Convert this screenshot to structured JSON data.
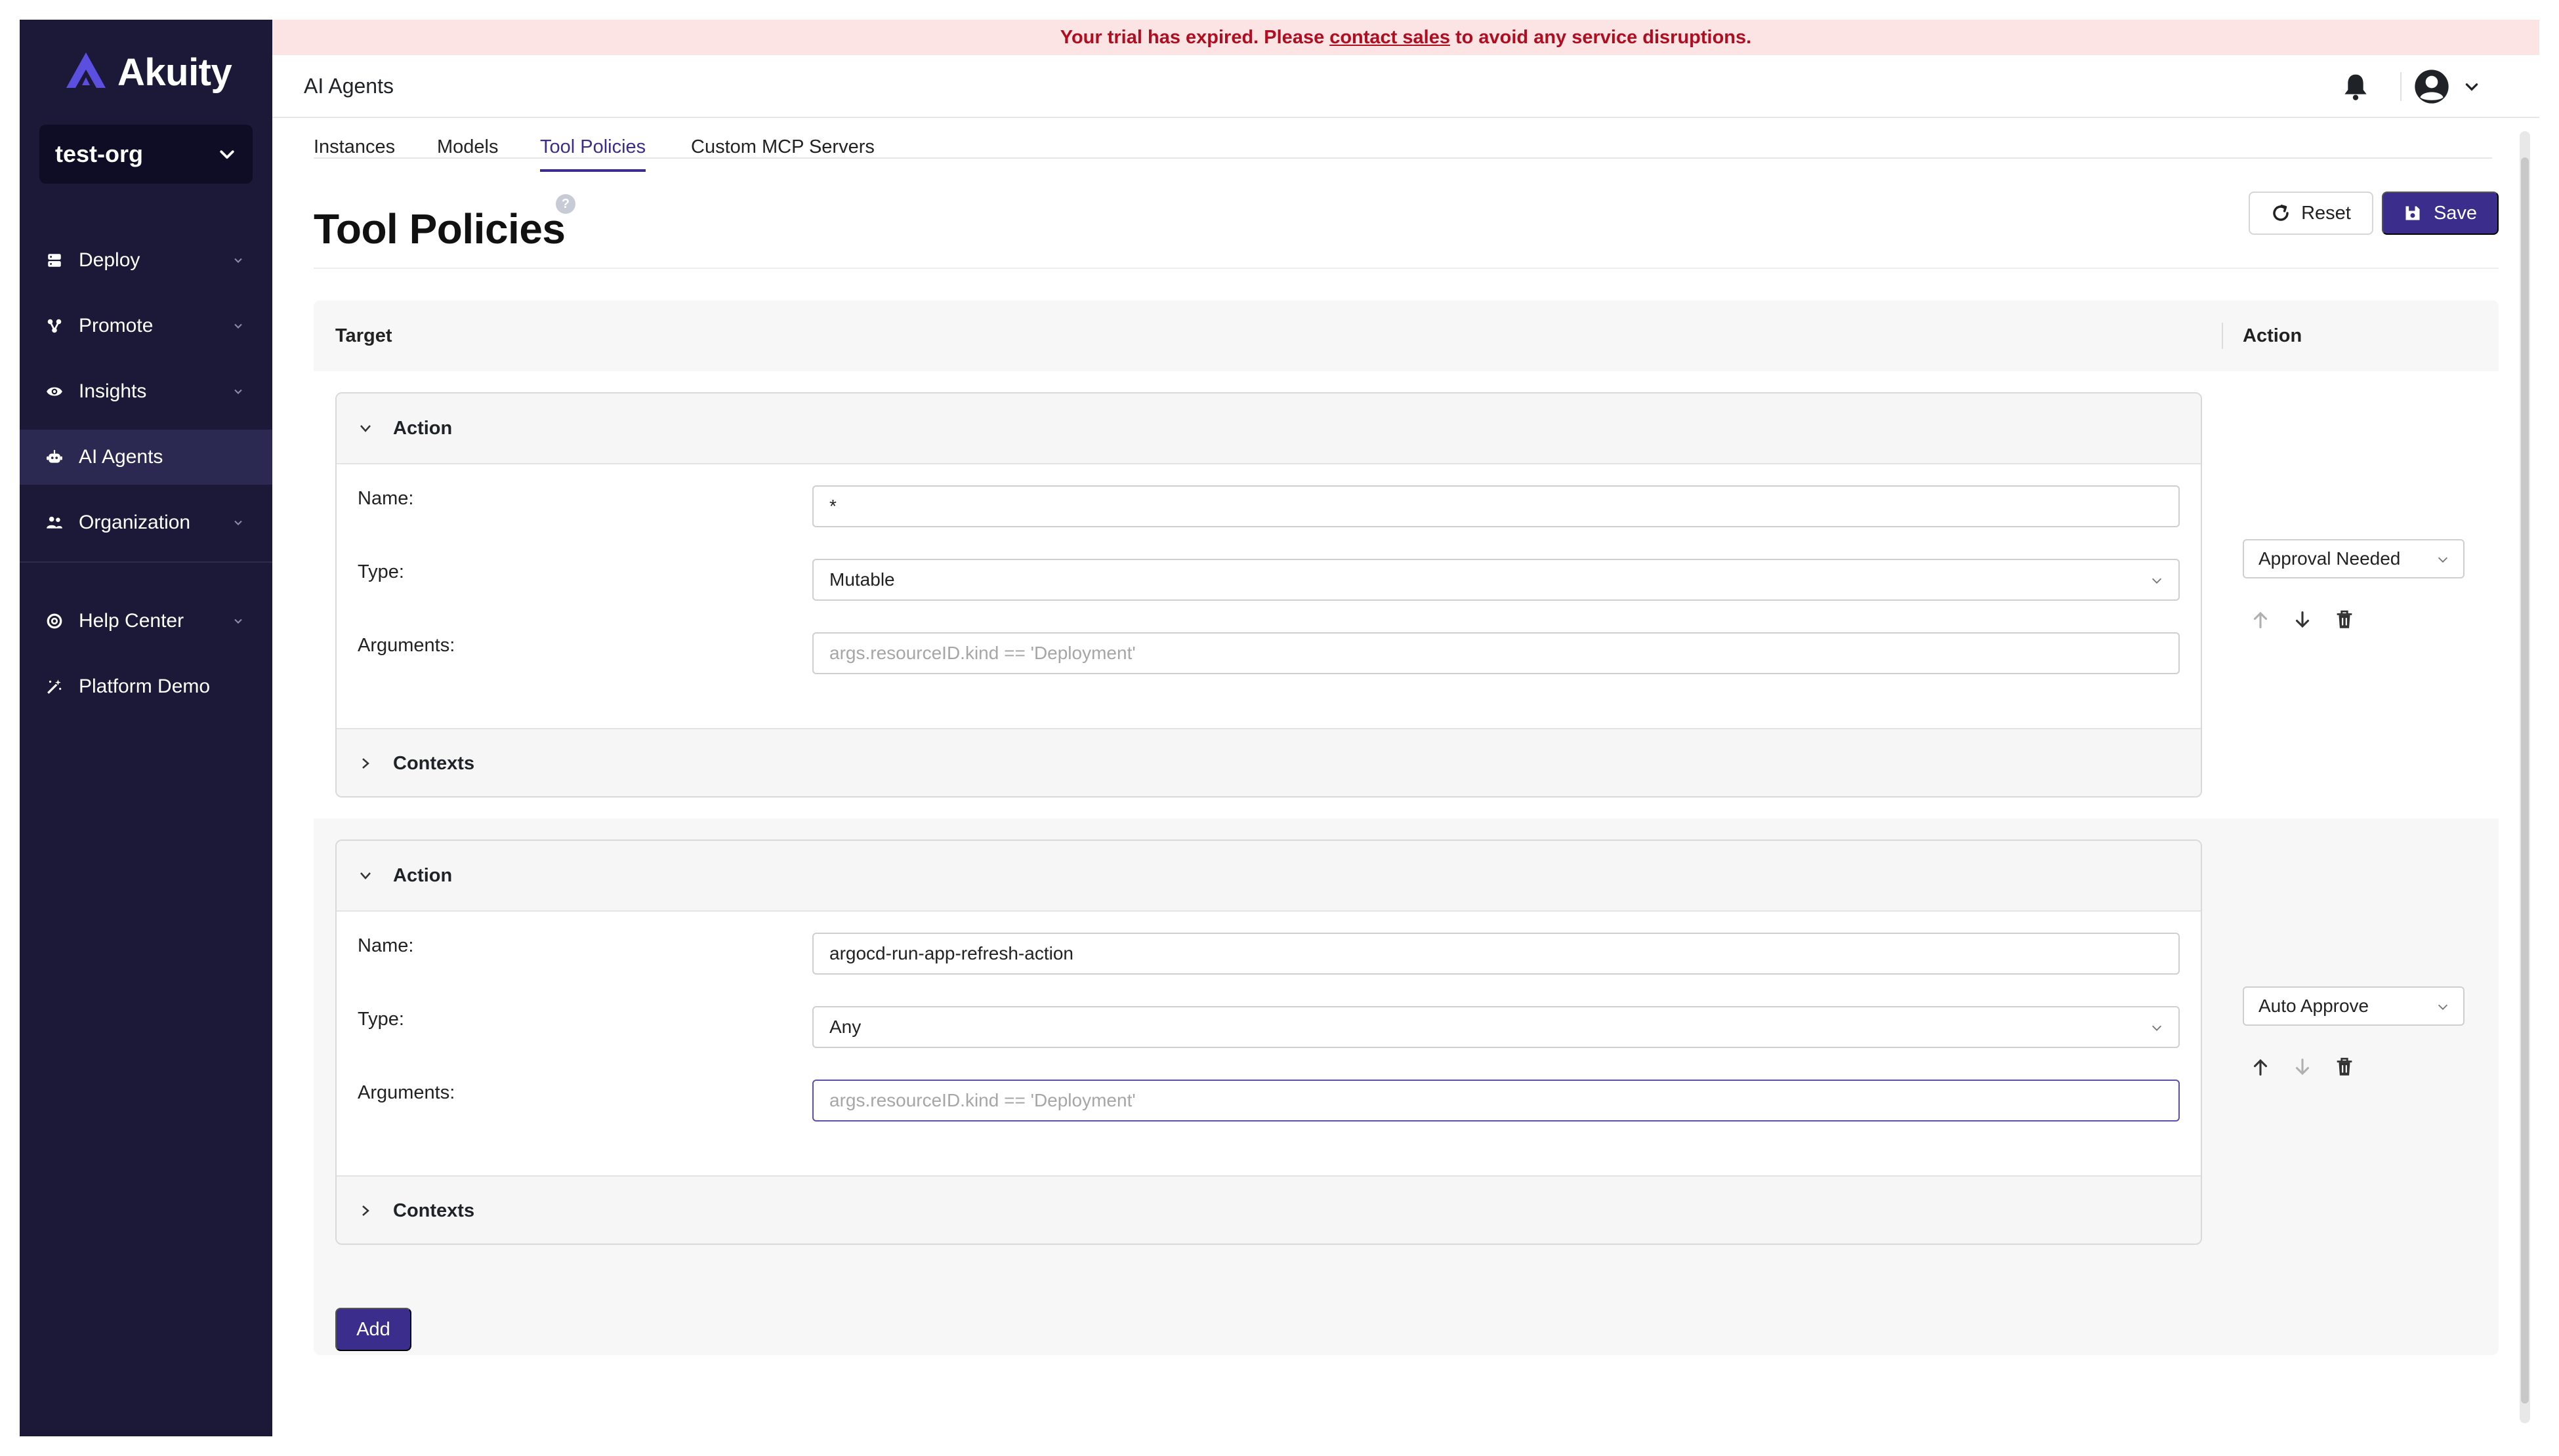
{
  "brand": {
    "name": "Akuity",
    "accent": "#4b3fd6"
  },
  "org": {
    "name": "test-org"
  },
  "sidebar": {
    "items": [
      {
        "label": "Deploy",
        "icon": "server-icon",
        "expandable": true
      },
      {
        "label": "Promote",
        "icon": "promote-icon",
        "expandable": true
      },
      {
        "label": "Insights",
        "icon": "eye-icon",
        "expandable": true
      },
      {
        "label": "AI Agents",
        "icon": "robot-icon",
        "expandable": false,
        "active": true
      },
      {
        "label": "Organization",
        "icon": "users-icon",
        "expandable": true
      },
      {
        "label": "Help Center",
        "icon": "lifebuoy-icon",
        "expandable": true
      },
      {
        "label": "Platform Demo",
        "icon": "wand-icon",
        "expandable": false
      }
    ]
  },
  "banner": {
    "before": "Your trial has expired. Please",
    "link": "contact sales",
    "after": "to avoid any service disruptions."
  },
  "topbar": {
    "title": "AI Agents"
  },
  "tabs": [
    {
      "label": "Instances",
      "active": false
    },
    {
      "label": "Models",
      "active": false
    },
    {
      "label": "Tool Policies",
      "active": true
    },
    {
      "label": "Custom MCP Servers",
      "active": false
    }
  ],
  "page": {
    "title": "Tool Policies",
    "help": "?"
  },
  "buttons": {
    "reset": "Reset",
    "save": "Save",
    "add": "Add"
  },
  "table": {
    "col_target": "Target",
    "col_action": "Action"
  },
  "policies": [
    {
      "header": "Action",
      "name_label": "Name:",
      "name_value": "*",
      "type_label": "Type:",
      "type_value": "Mutable",
      "args_label": "Arguments:",
      "args_placeholder": "args.resourceID.kind == 'Deployment'",
      "contexts_label": "Contexts",
      "action": "Approval Needed"
    },
    {
      "header": "Action",
      "name_label": "Name:",
      "name_value": "argocd-run-app-refresh-action",
      "type_label": "Type:",
      "type_value": "Any",
      "args_label": "Arguments:",
      "args_placeholder": "args.resourceID.kind == 'Deployment'",
      "contexts_label": "Contexts",
      "action": "Auto Approve"
    }
  ],
  "colors": {
    "primary": "#3a2d8c",
    "sidebar": "#1b1838",
    "banner_bg": "#fde4e4",
    "banner_text": "#b00d20"
  }
}
